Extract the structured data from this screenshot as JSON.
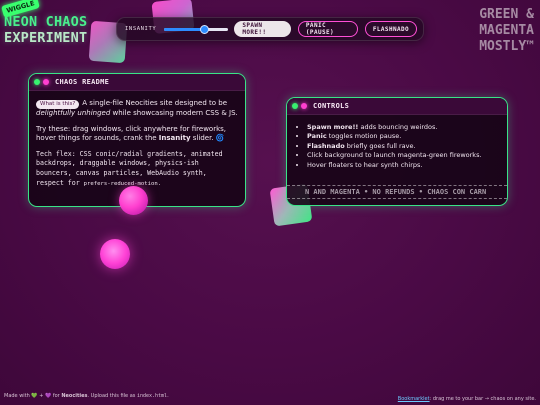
{
  "brand": {
    "badge": "WIGGLE",
    "line1": "NEON CHAOS",
    "line2": "EXPERIMENT"
  },
  "tagline": {
    "line1": "GREEN &",
    "line2": "MAGENTA",
    "line3": "MOSTLY™"
  },
  "toolbar": {
    "insanity_label": "INSANITY",
    "insanity_value": 0.62,
    "spawn_label": "SPAWN MORE!!",
    "panic_label": "PANIC (PAUSE)",
    "flashnado_label": "FLASHNADO"
  },
  "readme": {
    "title": "CHAOS README",
    "chip": "What is this?",
    "intro_1": "A single-file Neocities site designed to be ",
    "intro_em1": "delightfully unhinged",
    "intro_2": " while showcasing modern CSS & JS.",
    "try_1": "Try these: drag windows, click anywhere for fireworks, hover things for sounds, crank the ",
    "try_bold": "Insanity",
    "try_2": " slider. 🌀",
    "tech": "Tech flex: CSS conic/radial gradients, animated backdrops, draggable windows, physics-ish bouncers, canvas particles, WebAudio synth, respect for ",
    "tech_small": "prefers-reduced-motion."
  },
  "controls": {
    "title": "CONTROLS",
    "items": [
      {
        "bold": "Spawn more!!",
        "text": " adds bouncing weirdos."
      },
      {
        "bold": "Panic",
        "text": " toggles motion pause."
      },
      {
        "bold": "Flashnado",
        "text": " briefly goes full rave."
      },
      {
        "bold": "",
        "text": "Click background to launch magenta-green fireworks."
      },
      {
        "bold": "",
        "text": "Hover floaters to hear synth chirps."
      }
    ],
    "marquee": "N AND MAGENTA • NO REFUNDS • CHAOS CON CARN"
  },
  "footer": {
    "left_1": "Made with ",
    "left_heart_1": "💚",
    "left_plus": " + ",
    "left_heart_2": "💜",
    "left_2": " for ",
    "left_bold": "Neocities",
    "left_3": ". Upload this file as ",
    "left_code": "index.html",
    "left_4": ".",
    "right_link": "Bookmarklet",
    "right_text": ": drag me to your bar → chaos on any site."
  },
  "colors": {
    "green": "#39e487",
    "magenta": "#ff3fd0",
    "background": "#4a0a45"
  },
  "icons": {
    "window_dots": [
      "green-dot-icon",
      "magenta-dot-icon"
    ],
    "spiral": "spiral-emoji"
  }
}
